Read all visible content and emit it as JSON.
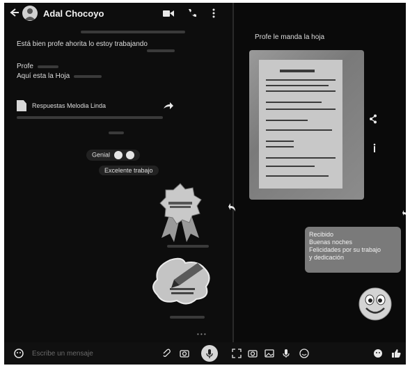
{
  "header": {
    "contact_name": "Adal Chocoyo"
  },
  "left_chat": {
    "messages": [
      {
        "text": "Está bien profe ahorita lo estoy trabajando"
      },
      {
        "text": "Profe"
      },
      {
        "text": "Aquí esta la Hoja"
      }
    ],
    "document": {
      "name": "Respuestas Melodia Linda"
    },
    "reply_1": {
      "text": "Genial",
      "emojis": [
        "smiley",
        "smiley"
      ]
    },
    "reply_2": {
      "text": "Excelente trabajo"
    }
  },
  "right_chat": {
    "caption": "Profe le manda la hoja",
    "bubble_lines": [
      "Recibido",
      "Buenas noches",
      "Felicidades por su trabajo",
      "y dedicación"
    ]
  },
  "bottom_bar": {
    "placeholder": "Escribe un mensaje"
  },
  "colors": {
    "background": "#0b0b0b",
    "bubble": "#7a7a7a",
    "text": "#e8e8e8"
  }
}
